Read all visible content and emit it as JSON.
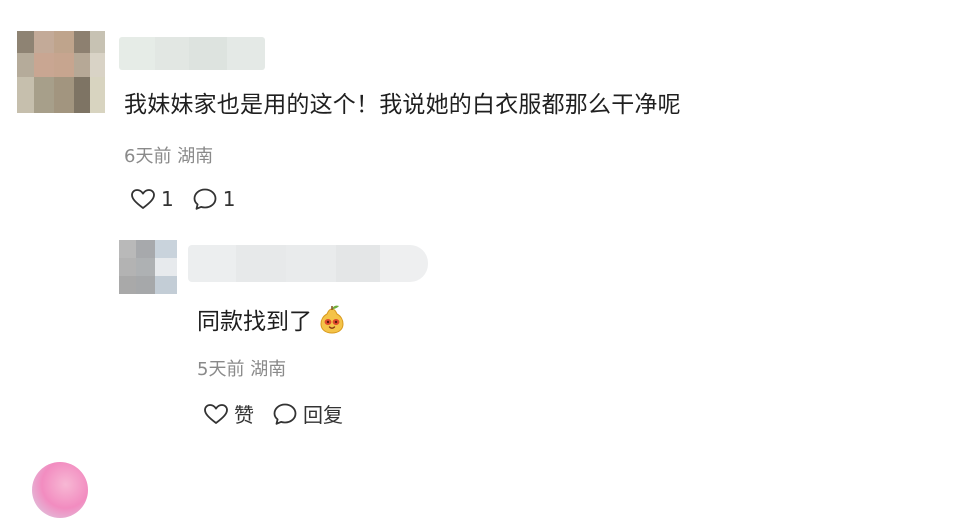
{
  "comment": {
    "avatar_colors": [
      "#8e8373",
      "#c3aa98",
      "#bfa48c",
      "#8d8070",
      "#c7c2b3",
      "#b5ab9a",
      "#c9a692",
      "#c7a58f",
      "#b6a896",
      "#d9d3c6",
      "#c6bfad",
      "#a79f8a",
      "#a2957f",
      "#7e7464",
      "#d8d4c0"
    ],
    "text": "我妹妹家也是用的这个！我说她的白衣服都那么干净呢",
    "time": "6天前",
    "location": "湖南",
    "like_count": "1",
    "reply_count": "1"
  },
  "reply": {
    "avatar_colors": [
      "#b9b9b9",
      "#a7a9ac",
      "#c9d3dc",
      "#b3b3b3",
      "#aeb1b3",
      "#e7eaed",
      "#a9a9a9",
      "#a6a8aa",
      "#c3cdd6"
    ],
    "text": "同款找到了",
    "time": "5天前",
    "location": "湖南",
    "like_label": "赞",
    "reply_label": "回复"
  },
  "colors": {
    "meta_text": "#8a8a8a",
    "body_text": "#1f1f1f",
    "icon_stroke": "#333333"
  }
}
